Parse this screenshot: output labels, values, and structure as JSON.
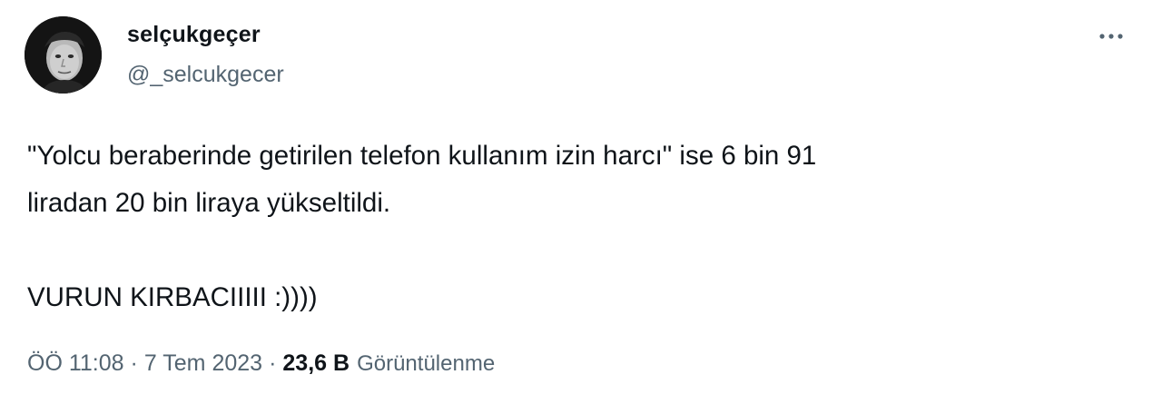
{
  "author": {
    "display_name": "selçukgeçer",
    "handle": "@_selcukgecer"
  },
  "tweet": {
    "text_lines": [
      "\"Yolcu beraberinde getirilen telefon kullanım izin harcı\" ise 6 bin 91",
      "liradan 20 bin liraya yükseltildi.",
      "VURUN KIRBACIIIII :))))"
    ],
    "time": "ÖÖ 11:08",
    "date": "7 Tem 2023",
    "separator": "·",
    "views_count": "23,6 B",
    "views_label": "Görüntülenme"
  },
  "icons": {
    "more": "more-horizontal-icon",
    "avatar": "profile-photo"
  },
  "colors": {
    "primary_text": "#0f1419",
    "secondary_text": "#536471",
    "background": "#ffffff"
  }
}
